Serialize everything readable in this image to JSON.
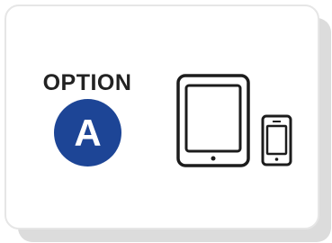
{
  "option": {
    "title": "OPTION",
    "letter": "A",
    "badge_color": "#1d4596"
  },
  "icons": [
    "tablet-icon",
    "smartphone-icon"
  ]
}
